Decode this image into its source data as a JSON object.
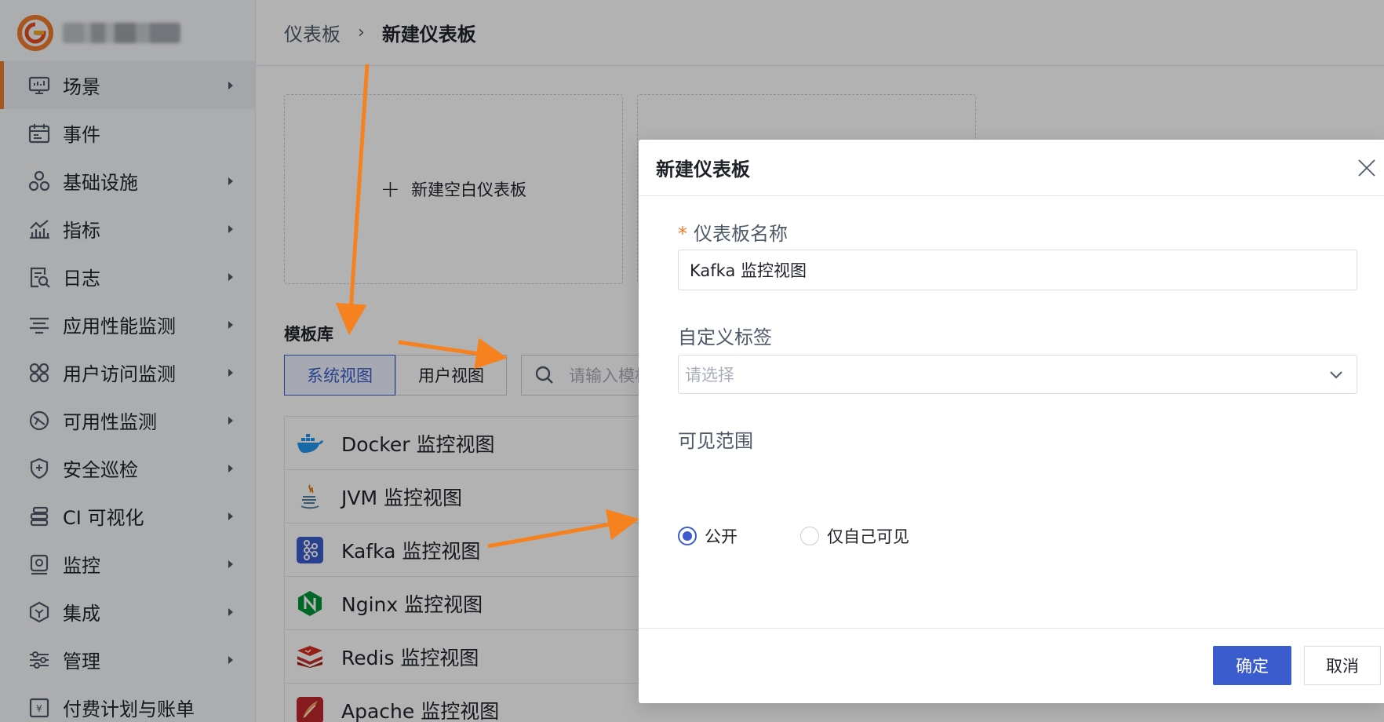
{
  "sidebar": {
    "items": [
      {
        "label": "场景",
        "icon": "screen-icon",
        "active": true,
        "has_children": true
      },
      {
        "label": "事件",
        "icon": "calendar-icon",
        "active": false,
        "has_children": false
      },
      {
        "label": "基础设施",
        "icon": "cluster-icon",
        "active": false,
        "has_children": true
      },
      {
        "label": "指标",
        "icon": "chart-icon",
        "active": false,
        "has_children": true
      },
      {
        "label": "日志",
        "icon": "log-search-icon",
        "active": false,
        "has_children": true
      },
      {
        "label": "应用性能监测",
        "icon": "filter-lines-icon",
        "active": false,
        "has_children": true
      },
      {
        "label": "用户访问监测",
        "icon": "grid-dots-icon",
        "active": false,
        "has_children": true
      },
      {
        "label": "可用性监测",
        "icon": "gauge-icon",
        "active": false,
        "has_children": true
      },
      {
        "label": "安全巡检",
        "icon": "shield-icon",
        "active": false,
        "has_children": true
      },
      {
        "label": "CI 可视化",
        "icon": "stack-icon",
        "active": false,
        "has_children": true
      },
      {
        "label": "监控",
        "icon": "camera-icon",
        "active": false,
        "has_children": true
      },
      {
        "label": "集成",
        "icon": "hexagon-icon",
        "active": false,
        "has_children": true
      },
      {
        "label": "管理",
        "icon": "sliders-icon",
        "active": false,
        "has_children": true
      },
      {
        "label": "付费计划与账单",
        "icon": "bill-icon",
        "active": false,
        "has_children": false
      }
    ]
  },
  "breadcrumb": {
    "parent": "仪表板",
    "separator": "›",
    "current": "新建仪表板"
  },
  "cards": {
    "blank_label": "新建空白仪表板",
    "plus": "+"
  },
  "library": {
    "title": "模板库",
    "tabs": [
      "系统视图",
      "用户视图"
    ],
    "active_tab": 0,
    "search_placeholder": "请输入模板",
    "templates": [
      {
        "name": "Docker 监控视图",
        "icon": "docker-icon"
      },
      {
        "name": "JVM 监控视图",
        "icon": "java-icon"
      },
      {
        "name": "Kafka 监控视图",
        "icon": "kafka-icon"
      },
      {
        "name": "Nginx 监控视图",
        "icon": "nginx-icon"
      },
      {
        "name": "Redis 监控视图",
        "icon": "redis-icon"
      },
      {
        "name": "Apache 监控视图",
        "icon": "apache-icon"
      }
    ]
  },
  "dialog": {
    "title": "新建仪表板",
    "name_label": "仪表板名称",
    "required_mark": "*",
    "name_value": "Kafka 监控视图",
    "tags_label": "自定义标签",
    "tags_placeholder": "请选择",
    "visibility_label": "可见范围",
    "visibility_options": [
      "公开",
      "仅自己可见"
    ],
    "visibility_selected": 0,
    "ok_label": "确定",
    "cancel_label": "取消"
  },
  "colors": {
    "accent": "#3a5ccc",
    "brand": "#f07b2d",
    "annotation": "#f5821f"
  }
}
